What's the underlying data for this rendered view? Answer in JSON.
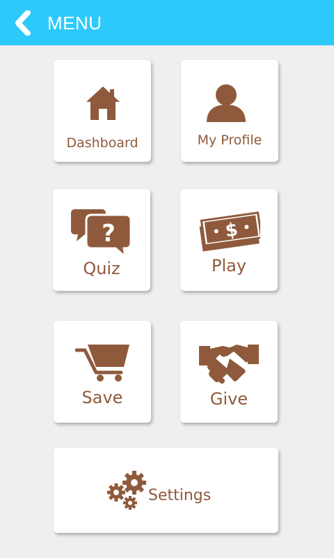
{
  "header": {
    "title": "MENU",
    "back_icon": "chevron-left-icon"
  },
  "colors": {
    "header_bg": "#2ec9fb",
    "accent_brown": "#8f5a3c",
    "background": "#efefef",
    "tile_bg": "#ffffff"
  },
  "menu": {
    "dashboard": {
      "label": "Dashboard",
      "icon": "home-icon"
    },
    "my_profile": {
      "label": "My Profile",
      "icon": "user-icon"
    },
    "quiz": {
      "label": "Quiz",
      "icon": "question-bubbles-icon"
    },
    "play": {
      "label": "Play",
      "icon": "money-bill-icon"
    },
    "save": {
      "label": "Save",
      "icon": "shopping-cart-icon"
    },
    "give": {
      "label": "Give",
      "icon": "handshake-icon"
    },
    "settings": {
      "label": "Settings",
      "icon": "gears-icon"
    }
  }
}
